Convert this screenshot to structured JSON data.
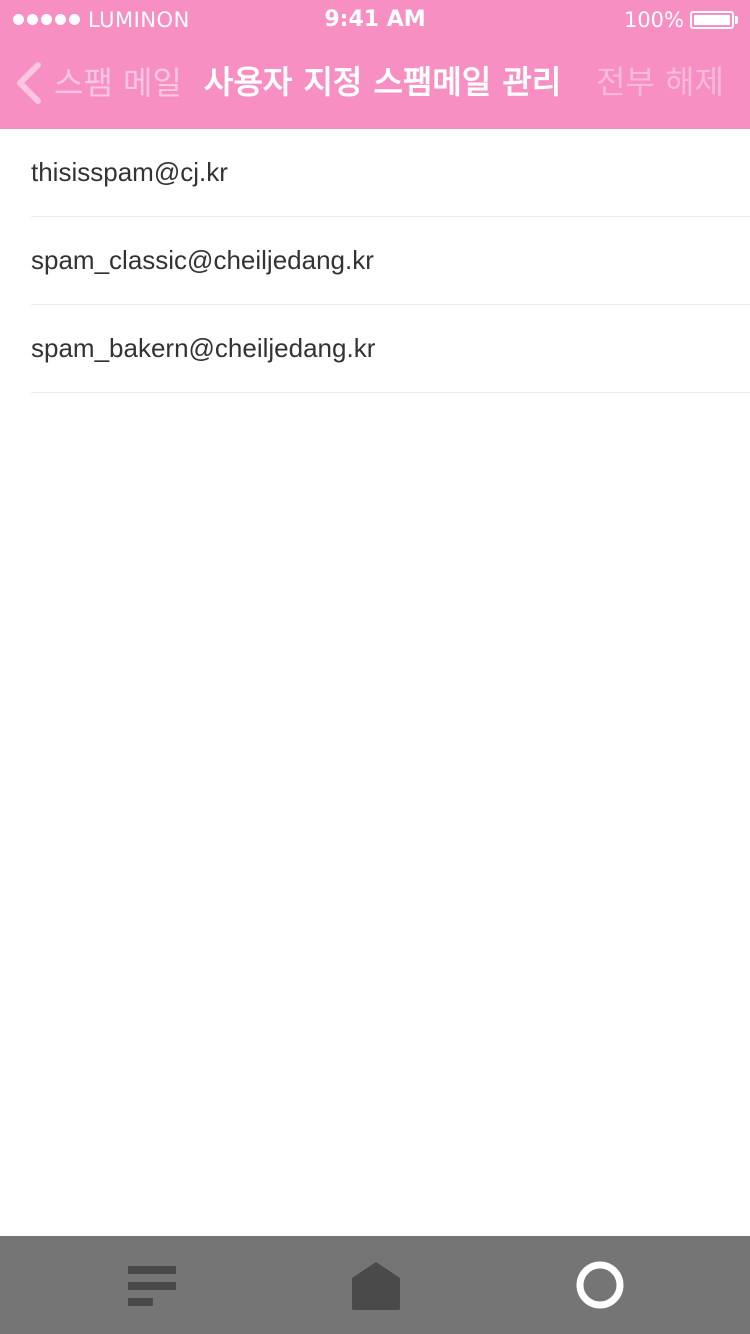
{
  "status_bar": {
    "carrier": "LUMINON",
    "time": "9:41 AM",
    "battery": "100%"
  },
  "nav": {
    "back_label": "스팸 메일",
    "title": "사용자 지정 스팸메일 관리",
    "action_label": "전부 해제"
  },
  "spam_list": [
    "thisisspam@cj.kr",
    "spam_classic@cheiljedang.kr",
    "spam_bakern@cheiljedang.kr"
  ],
  "tabbar": {
    "tabs": [
      {
        "icon": "menu-lines-icon"
      },
      {
        "icon": "home-icon"
      },
      {
        "icon": "circle-icon"
      }
    ]
  },
  "colors": {
    "header": "#f78fc3",
    "tabbar": "#757575"
  }
}
